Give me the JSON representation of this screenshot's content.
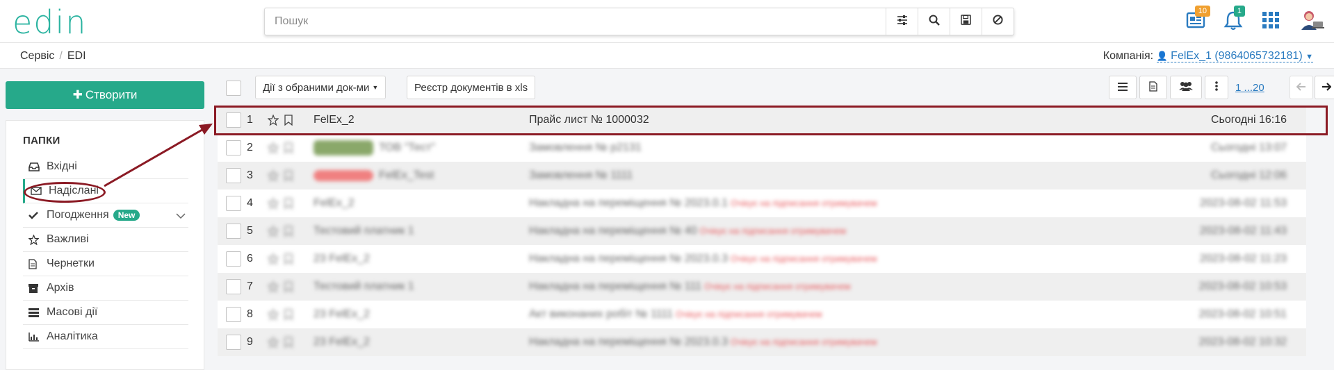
{
  "app": {
    "logo": "edin"
  },
  "search": {
    "placeholder": "Пошук"
  },
  "top_icons": [
    {
      "name": "news-icon",
      "badge": "10",
      "badge_color": "#f0a030"
    },
    {
      "name": "bell-icon",
      "badge": "1",
      "badge_color": "#26a98a"
    },
    {
      "name": "apps-grid-icon"
    },
    {
      "name": "user-avatar-icon"
    }
  ],
  "breadcrumb": {
    "item1": "Сервіс",
    "item2": "EDI"
  },
  "company": {
    "label": "Компанія:",
    "value": "FelEx_1 (9864065732181)"
  },
  "create_button": {
    "label": "Створити"
  },
  "sidebar": {
    "title": "ПАПКИ",
    "items": [
      {
        "label": "Вхідні",
        "icon": "inbox-icon"
      },
      {
        "label": "Надіслані",
        "icon": "envelope-icon"
      },
      {
        "label": "Погодження",
        "icon": "check-icon",
        "badge": "New"
      },
      {
        "label": "Важливі",
        "icon": "star-icon"
      },
      {
        "label": "Чернетки",
        "icon": "draft-icon"
      },
      {
        "label": "Архів",
        "icon": "archive-icon"
      },
      {
        "label": "Масові дії",
        "icon": "bulk-icon"
      },
      {
        "label": "Аналітика",
        "icon": "chart-icon"
      }
    ]
  },
  "toolbar": {
    "bulk_actions": "Дії з обраними док-ми",
    "registry": "Реєстр документів в xls",
    "pager": "1 ...20"
  },
  "rows": [
    {
      "num": "1",
      "sender": "FelEx_2",
      "doc": "Прайс лист № 1000032",
      "status": "",
      "date": "Сьогодні 16:16"
    },
    {
      "num": "2",
      "sender": "ТОВ \"Тест\"",
      "doc": "Замовлення № р2131",
      "status": "",
      "date": "Сьогодні 13:07"
    },
    {
      "num": "3",
      "sender": "FelEx_Test",
      "doc": "Замовлення № 1111",
      "status": "",
      "date": "Сьогодні 12:06"
    },
    {
      "num": "4",
      "sender": "FelEx_2",
      "doc": "Накладна на переміщення № 2023.0.1",
      "status": "Очікує на підписання отримувачем",
      "date": "2023-08-02 11:53"
    },
    {
      "num": "5",
      "sender": "Тестовий платник 1",
      "doc": "Накладна на переміщення № 40",
      "status": "Очікує на підписання отримувачем",
      "date": "2023-08-02 11:43"
    },
    {
      "num": "6",
      "sender": "23 FelEx_2",
      "doc": "Накладна на переміщення № 2023.0.3",
      "status": "Очікує на підписання отримувачем",
      "date": "2023-08-02 11:23"
    },
    {
      "num": "7",
      "sender": "Тестовий платник 1",
      "doc": "Накладна на переміщення № 111",
      "status": "Очікує на підписання отримувачем",
      "date": "2023-08-02 10:53"
    },
    {
      "num": "8",
      "sender": "23 FelEx_2",
      "doc": "Акт виконаних робіт № 1111",
      "status": "Очікує на підписання отримувачем",
      "date": "2023-08-02 10:51"
    },
    {
      "num": "9",
      "sender": "23 FelEx_2",
      "doc": "Накладна на переміщення № 2023.0.3",
      "status": "Очікує на підписання отримувачем",
      "date": "2023-08-02 10:32"
    }
  ],
  "colors": {
    "accent": "#26a98a",
    "link": "#2a7bc0",
    "annotation": "#8b1a24"
  }
}
